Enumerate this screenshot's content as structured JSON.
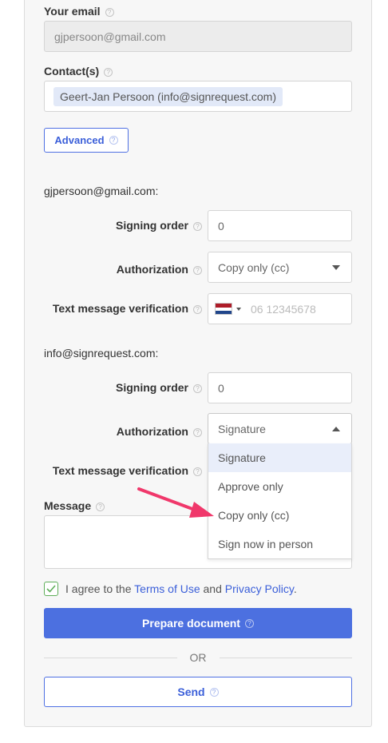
{
  "form": {
    "your_email_label": "Your email",
    "your_email_value": "gjpersoon@gmail.com",
    "contacts_label": "Contact(s)",
    "contact_tag": "Geert-Jan Persoon (info@signrequest.com)",
    "advanced_label": "Advanced"
  },
  "signers": [
    {
      "email": "gjpersoon@gmail.com:",
      "signing_order_label": "Signing order",
      "signing_order_value": "0",
      "authorization_label": "Authorization",
      "authorization_value": "Copy only (cc)",
      "sms_label": "Text message verification",
      "sms_placeholder": "06 12345678"
    },
    {
      "email": "info@signrequest.com:",
      "signing_order_label": "Signing order",
      "signing_order_value": "0",
      "authorization_label": "Authorization",
      "authorization_value": "Signature",
      "sms_label": "Text message verification"
    }
  ],
  "dropdown_options": [
    "Signature",
    "Approve only",
    "Copy only (cc)",
    "Sign now in person"
  ],
  "message_label": "Message",
  "agree": {
    "prefix": "I agree to the",
    "terms": "Terms of Use",
    "and": "and",
    "privacy": "Privacy Policy",
    "suffix": "."
  },
  "prepare_label": "Prepare document",
  "or_label": "OR",
  "send_label": "Send",
  "colors": {
    "accent": "#4c70e0",
    "annotation_arrow": "#f0386b"
  },
  "icons": [
    "help-icon",
    "netherlands-flag-icon",
    "checkbox-checked-icon",
    "annotation-arrow"
  ]
}
